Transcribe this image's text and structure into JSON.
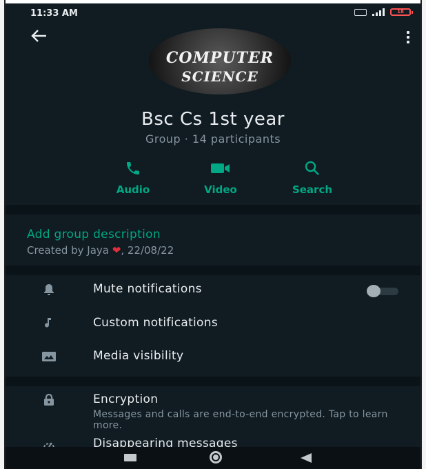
{
  "status_bar": {
    "time": "11:33 AM",
    "battery": "18"
  },
  "group": {
    "avatar_text_line1": "COMPUTER",
    "avatar_text_line2": "SCIENCE",
    "name": "Bsc Cs 1st year",
    "meta": "Group · 14 participants"
  },
  "actions": [
    {
      "label": "Audio",
      "icon": "phone-icon"
    },
    {
      "label": "Video",
      "icon": "video-camera-icon"
    },
    {
      "label": "Search",
      "icon": "search-icon"
    }
  ],
  "description": {
    "link": "Add group description",
    "created_prefix": "Created by Jaya ",
    "created_suffix": ", 22/08/22"
  },
  "settings": [
    {
      "label": "Mute notifications",
      "icon": "bell-icon",
      "toggle_on": false
    },
    {
      "label": "Custom notifications",
      "icon": "music-note-icon"
    },
    {
      "label": "Media visibility",
      "icon": "image-icon"
    }
  ],
  "security": [
    {
      "label": "Encryption",
      "icon": "lock-icon",
      "sub": "Messages and calls are end-to-end encrypted. Tap to learn more."
    },
    {
      "label": "Disappearing messages",
      "icon": "timer-icon"
    }
  ],
  "colors": {
    "accent": "#00a884",
    "background": "#101b22",
    "text_primary": "#e9edef",
    "text_secondary": "#8696a0"
  }
}
